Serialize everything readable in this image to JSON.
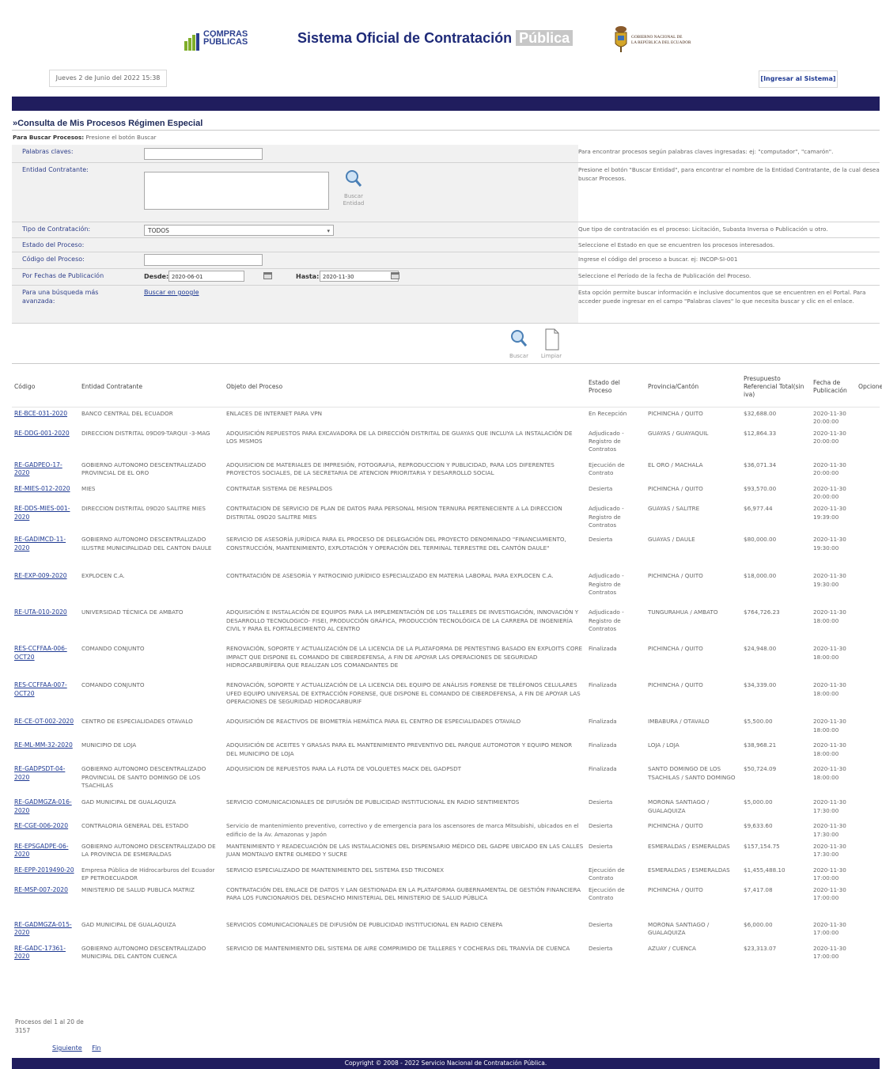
{
  "header": {
    "logo_text": "COMPRAS PÚBLICAS",
    "title_main": "Sistema Oficial de Contratación",
    "title_highlight": "Pública",
    "gov_line1": "GOBIERNO NACIONAL DE",
    "gov_line2": "LA REPÚBLICA DEL ECUADOR",
    "date_text": "Jueves 2 de Junio del 2022 15:38",
    "login_link": "[Ingresar al Sistema]"
  },
  "page": {
    "heading": "»Consulta de Mis Procesos Régimen Especial",
    "hint_bold": "Para Buscar Procesos:",
    "hint_text": "Presione el botón Buscar"
  },
  "form": {
    "keywords": {
      "label": "Palabras claves:",
      "value": "",
      "description": "Para encontrar procesos según palabras claves ingresadas: ej: \"computador\", \"camarón\"."
    },
    "entity": {
      "label": "Entidad Contratante:",
      "value": "",
      "button_label": "Buscar Entidad",
      "description": "Presione el botón \"Buscar Entidad\", para encontrar el nombre de la Entidad Contratante, de la cual desea buscar Procesos."
    },
    "type": {
      "label": "Tipo de Contratación:",
      "selected": "TODOS",
      "description": "Que tipo de contratación es el proceso: Licitación, Subasta Inversa o Publicación u otro."
    },
    "state": {
      "label": "Estado del Proceso:",
      "description": "Seleccione el Estado en que se encuentren los procesos interesados."
    },
    "code": {
      "label": "Código del Proceso:",
      "value": "",
      "description": "Ingrese el código del proceso a buscar. ej: INCOP-SI-001"
    },
    "dates": {
      "label": "Por Fechas de Publicación",
      "from_label": "Desde:",
      "from_value": "2020-06-01",
      "to_label": "Hasta:",
      "to_value": "2020-11-30",
      "description": "Seleccione el Período de la fecha de Publicación del Proceso."
    },
    "advanced": {
      "label": "Para una búsqueda más avanzada:",
      "link": "Buscar en google",
      "description": "Esta opción permite buscar información e inclusive documentos que se encuentren en el Portal. Para acceder puede ingresar en el campo \"Palabras claves\" lo que necesita buscar y clic en el enlace."
    },
    "search_button": "Buscar",
    "clear_button": "Limpiar"
  },
  "table": {
    "headers": [
      "Código",
      "Entidad Contratante",
      "Objeto del Proceso",
      "Estado del Proceso",
      "Provincia/Cantón",
      "Presupuesto Referencial Total(sin iva)",
      "Fecha de Publicación",
      "Opciones"
    ],
    "rows": [
      {
        "code": "RE-BCE-031-2020",
        "entity": "BANCO CENTRAL DEL ECUADOR",
        "object": "ENLACES DE INTERNET PARA VPN",
        "state": "En Recepción",
        "province": "PICHINCHA / QUITO",
        "budget": "$32,688.00",
        "date": "2020-11-30 20:00:00"
      },
      {
        "code": "RE-DDG-001-2020",
        "entity": "DIRECCION DISTRITAL 09D09-TARQUI -3-MAG",
        "object": "ADQUISICIÓN REPUESTOS PARA EXCAVADORA DE LA DIRECCIÓN DISTRITAL DE GUAYAS QUE INCLUYA LA INSTALACIÓN DE LOS MISMOS",
        "state": "Adjudicado - Registro de Contratos",
        "province": "GUAYAS / GUAYAQUIL",
        "budget": "$12,864.33",
        "date": "2020-11-30 20:00:00"
      },
      {
        "code": "RE-GADPEO-17-2020",
        "entity": "GOBIERNO AUTONOMO DESCENTRALIZADO PROVINCIAL DE EL ORO",
        "object": "ADQUISICION DE MATERIALES DE IMPRESIÓN, FOTOGRAFIA, REPRODUCCION Y PUBLICIDAD, PARA LOS DIFERENTES PROYECTOS SOCIALES, DE LA SECRETARIA DE ATENCION PRIORITARIA Y DESARROLLO SOCIAL",
        "state": "Ejecución de Contrato",
        "province": "EL ORO / MACHALA",
        "budget": "$36,071.34",
        "date": "2020-11-30 20:00:00"
      },
      {
        "code": "RE-MIES-012-2020",
        "entity": "MIES",
        "object": "CONTRATAR SISTEMA DE RESPALDOS",
        "state": "Desierta",
        "province": "PICHINCHA / QUITO",
        "budget": "$93,570.00",
        "date": "2020-11-30 20:00:00"
      },
      {
        "code": "RE-DDS-MIES-001-2020",
        "entity": "DIRECCION DISTRITAL 09D20 SALITRE MIES",
        "object": "CONTRATACION DE SERVICIO DE PLAN DE DATOS PARA PERSONAL MISION TERNURA PERTENECIENTE A LA DIRECCION DISTRITAL 09D20 SALITRE MIES",
        "state": "Adjudicado - Registro de Contratos",
        "province": "GUAYAS / SALITRE",
        "budget": "$6,977.44",
        "date": "2020-11-30 19:39:00"
      },
      {
        "code": "RE-GADIMCD-11-2020",
        "entity": "GOBIERNO AUTONOMO DESCENTRALIZADO ILUSTRE MUNICIPALIDAD DEL CANTON DAULE",
        "object": "SERVICIO DE ASESORÍA JURÍDICA PARA EL PROCESO DE DELEGACIÓN DEL PROYECTO DENOMINADO \"FINANCIAMIENTO, CONSTRUCCIÓN, MANTENIMIENTO, EXPLOTACIÓN Y OPERACIÓN DEL TERMINAL TERRESTRE DEL CANTÓN DAULE\"",
        "state": "Desierta",
        "province": "GUAYAS / DAULE",
        "budget": "$80,000.00",
        "date": "2020-11-30 19:30:00"
      },
      {
        "code": "RE-EXP-009-2020",
        "entity": "EXPLOCEN C.A.",
        "object": "CONTRATACIÓN DE ASESORÍA Y PATROCINIO JURÍDICO ESPECIALIZADO EN MATERIA LABORAL PARA EXPLOCEN C.A.",
        "state": "Adjudicado - Registro de Contratos",
        "province": "PICHINCHA / QUITO",
        "budget": "$18,000.00",
        "date": "2020-11-30 19:30:00"
      },
      {
        "code": "RE-UTA-010-2020",
        "entity": "UNIVERSIDAD TÉCNICA DE AMBATO",
        "object": "ADQUISICIÓN E INSTALACIÓN DE EQUIPOS PARA LA IMPLEMENTACIÓN DE LOS TALLERES DE INVESTIGACIÓN, INNOVACIÓN Y DESARROLLO TECNOLOGICO- FISEI, PRODUCCIÓN GRÁFICA, PRODUCCIÓN TECNOLÓGICA DE LA CARRERA DE INGENIERÍA CIVIL Y PARA EL FORTALECIMIENTO AL CENTRO",
        "state": "Adjudicado - Registro de Contratos",
        "province": "TUNGURAHUA / AMBATO",
        "budget": "$764,726.23",
        "date": "2020-11-30 18:00:00"
      },
      {
        "code": "RES-CCFFAA-006-OCT20",
        "entity": "COMANDO CONJUNTO",
        "object": "RENOVACIÓN, SOPORTE Y ACTUALIZACIÓN DE LA LICENCIA DE LA PLATAFORMA DE PENTESTING BASADO EN EXPLOITS CORE IMPACT QUE DISPONE EL COMANDO DE CIBERDEFENSA, A FIN DE APOYAR LAS OPERACIONES DE SEGURIDAD HIDROCARBURÍFERA QUE REALIZAN LOS COMANDANTES DE",
        "state": "Finalizada",
        "province": "PICHINCHA / QUITO",
        "budget": "$24,948.00",
        "date": "2020-11-30 18:00:00"
      },
      {
        "code": "RES-CCFFAA-007-OCT20",
        "entity": "COMANDO CONJUNTO",
        "object": "RENOVACIÓN, SOPORTE Y ACTUALIZACIÓN DE LA LICENCIA DEL EQUIPO DE ANÁLISIS FORENSE DE TELÉFONOS CELULARES UFED EQUIPO UNIVERSAL DE EXTRACCIÓN FORENSE, QUE DISPONE EL COMANDO DE CIBERDEFENSA, A FIN DE APOYAR LAS OPERACIONES DE SEGURIDAD HIDROCARBURIF",
        "state": "Finalizada",
        "province": "PICHINCHA / QUITO",
        "budget": "$34,339.00",
        "date": "2020-11-30 18:00:00"
      },
      {
        "code": "RE-CE-OT-002-2020",
        "entity": "CENTRO DE ESPECIALIDADES OTAVALO",
        "object": "ADQUISICIÓN DE REACTIVOS DE BIOMETRÍA HEMÁTICA PARA EL CENTRO DE ESPECIALIDADES OTAVALO",
        "state": "Finalizada",
        "province": "IMBABURA / OTAVALO",
        "budget": "$5,500.00",
        "date": "2020-11-30 18:00:00"
      },
      {
        "code": "RE-ML-MM-32-2020",
        "entity": "MUNICIPIO DE LOJA",
        "object": "ADQUISICIÓN DE ACEITES Y GRASAS PARA EL MANTENIMIENTO PREVENTIVO DEL PARQUE AUTOMOTOR Y EQUIPO MENOR DEL MUNICIPIO DE LOJA",
        "state": "Finalizada",
        "province": "LOJA / LOJA",
        "budget": "$38,968.21",
        "date": "2020-11-30 18:00:00"
      },
      {
        "code": "RE-GADPSDT-04-2020",
        "entity": "GOBIERNO AUTONOMO DESCENTRALIZADO PROVINCIAL DE SANTO DOMINGO DE LOS TSACHILAS",
        "object": "ADQUISICION DE REPUESTOS PARA LA FLOTA DE VOLQUETES MACK DEL GADPSDT",
        "state": "Finalizada",
        "province": "SANTO DOMINGO DE LOS TSACHILAS / SANTO DOMINGO",
        "budget": "$50,724.09",
        "date": "2020-11-30 18:00:00"
      },
      {
        "code": "RE-GADMGZA-016-2020",
        "entity": "GAD MUNICIPAL DE GUALAQUIZA",
        "object": "SERVICIO COMUNICACIONALES DE DIFUSIÓN DE PUBLICIDAD INSTITUCIONAL EN RADIO SENTIMIENTOS",
        "state": "Desierta",
        "province": "MORONA SANTIAGO / GUALAQUIZA",
        "budget": "$5,000.00",
        "date": "2020-11-30 17:30:00"
      },
      {
        "code": "RE-CGE-006-2020",
        "entity": "CONTRALORIA GENERAL DEL ESTADO",
        "object": "Servicio de mantenimiento preventivo, correctivo y de emergencia para los ascensores de marca Mitsubishi, ubicados en el edificio de la Av. Amazonas y Japón",
        "state": "Desierta",
        "province": "PICHINCHA / QUITO",
        "budget": "$9,633.60",
        "date": "2020-11-30 17:30:00"
      },
      {
        "code": "RE-EPSGADPE-06-2020",
        "entity": "GOBIERNO AUTONOMO DESCENTRALIZADO DE LA PROVINCIA DE ESMERALDAS",
        "object": "MANTENIMIENTO Y READECUACIÓN DE LAS INSTALACIONES DEL DISPENSARIO MÉDICO DEL GADPE UBICADO EN LAS CALLES JUAN MONTALVO ENTRE OLMEDO Y SUCRE",
        "state": "Desierta",
        "province": "ESMERALDAS / ESMERALDAS",
        "budget": "$157,154.75",
        "date": "2020-11-30 17:30:00"
      },
      {
        "code": "RE-EPP-2019490-20",
        "entity": "Empresa Pública de Hidrocarburos del Ecuador EP PETROECUADOR",
        "object": "SERVICIO ESPECIALIZADO DE MANTENIMIENTO DEL SISTEMA ESD TRICONEX",
        "state": "Ejecución de Contrato",
        "province": "ESMERALDAS / ESMERALDAS",
        "budget": "$1,455,488.10",
        "date": "2020-11-30 17:00:00"
      },
      {
        "code": "RE-MSP-007-2020",
        "entity": "MINISTERIO DE SALUD PUBLICA MATRIZ",
        "object": "CONTRATACIÓN DEL ENLACE DE DATOS Y LAN GESTIONADA EN LA PLATAFORMA GUBERNAMENTAL DE GESTIÓN FINANCIERA PARA LOS FUNCIONARIOS DEL DESPACHO MINISTERIAL DEL MINISTERIO DE SALUD PÚBLICA",
        "state": "Ejecución de Contrato",
        "province": "PICHINCHA / QUITO",
        "budget": "$7,417.08",
        "date": "2020-11-30 17:00:00"
      },
      {
        "code": "RE-GADMGZA-015-2020",
        "entity": "GAD MUNICIPAL DE GUALAQUIZA",
        "object": "SERVICIOS COMUNICACIONALES DE DIFUSIÓN DE PUBLICIDAD INSTITUCIONAL EN RADIO CENEPA",
        "state": "Desierta",
        "province": "MORONA SANTIAGO / GUALAQUIZA",
        "budget": "$6,000.00",
        "date": "2020-11-30 17:00:00"
      },
      {
        "code": "RE-GADC-17361-2020",
        "entity": "GOBIERNO AUTONOMO DESCENTRALIZADO MUNICIPAL DEL CANTON CUENCA",
        "object": "SERVICIO DE MANTENIMIENTO DEL SISTEMA DE AIRE COMPRIMIDO DE TALLERES Y COCHERAS DEL TRANVÍA DE CUENCA",
        "state": "Desierta",
        "province": "AZUAY / CUENCA",
        "budget": "$23,313.07",
        "date": "2020-11-30 17:00:00"
      }
    ]
  },
  "pagination": {
    "summary": "Procesos del 1 al 20 de 3157",
    "next": "Siguiente",
    "last": "Fin"
  },
  "footer": {
    "copyright": "Copyright © 2008 - 2022 Servicio Nacional de Contratación Pública."
  },
  "colors": {
    "navy": "#201d5e",
    "link": "#1f3a93",
    "label_bg": "#f1f1f1",
    "logo_green": "#7fae2a"
  }
}
